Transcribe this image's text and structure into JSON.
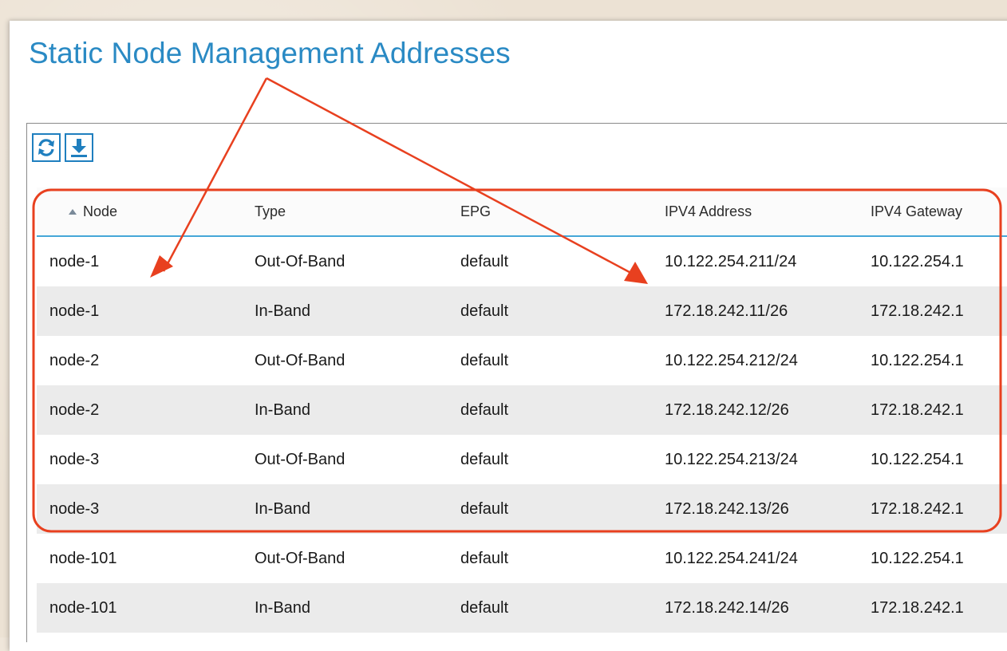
{
  "page": {
    "title": "Static Node Management Addresses"
  },
  "toolbar": {
    "refresh_icon": "refresh-icon",
    "download_icon": "download-icon"
  },
  "table": {
    "columns": [
      "Node",
      "Type",
      "EPG",
      "IPV4 Address",
      "IPV4 Gateway"
    ],
    "sort_column": "Node",
    "sort_direction": "ascending",
    "rows": [
      [
        "node-1",
        "Out-Of-Band",
        "default",
        "10.122.254.211/24",
        "10.122.254.1"
      ],
      [
        "node-1",
        "In-Band",
        "default",
        "172.18.242.11/26",
        "172.18.242.1"
      ],
      [
        "node-2",
        "Out-Of-Band",
        "default",
        "10.122.254.212/24",
        "10.122.254.1"
      ],
      [
        "node-2",
        "In-Band",
        "default",
        "172.18.242.12/26",
        "172.18.242.1"
      ],
      [
        "node-3",
        "Out-Of-Band",
        "default",
        "10.122.254.213/24",
        "10.122.254.1"
      ],
      [
        "node-3",
        "In-Band",
        "default",
        "172.18.242.13/26",
        "172.18.242.1"
      ],
      [
        "node-101",
        "Out-Of-Band",
        "default",
        "10.122.254.241/24",
        "10.122.254.1"
      ],
      [
        "node-101",
        "In-Band",
        "default",
        "172.18.242.14/26",
        "172.18.242.1"
      ]
    ]
  },
  "colors": {
    "title": "#2a8ac4",
    "accent": "#1f7fbf",
    "header_underline": "#45a7d8",
    "alt_row": "#ebebeb",
    "annotation": "#e8401f"
  }
}
